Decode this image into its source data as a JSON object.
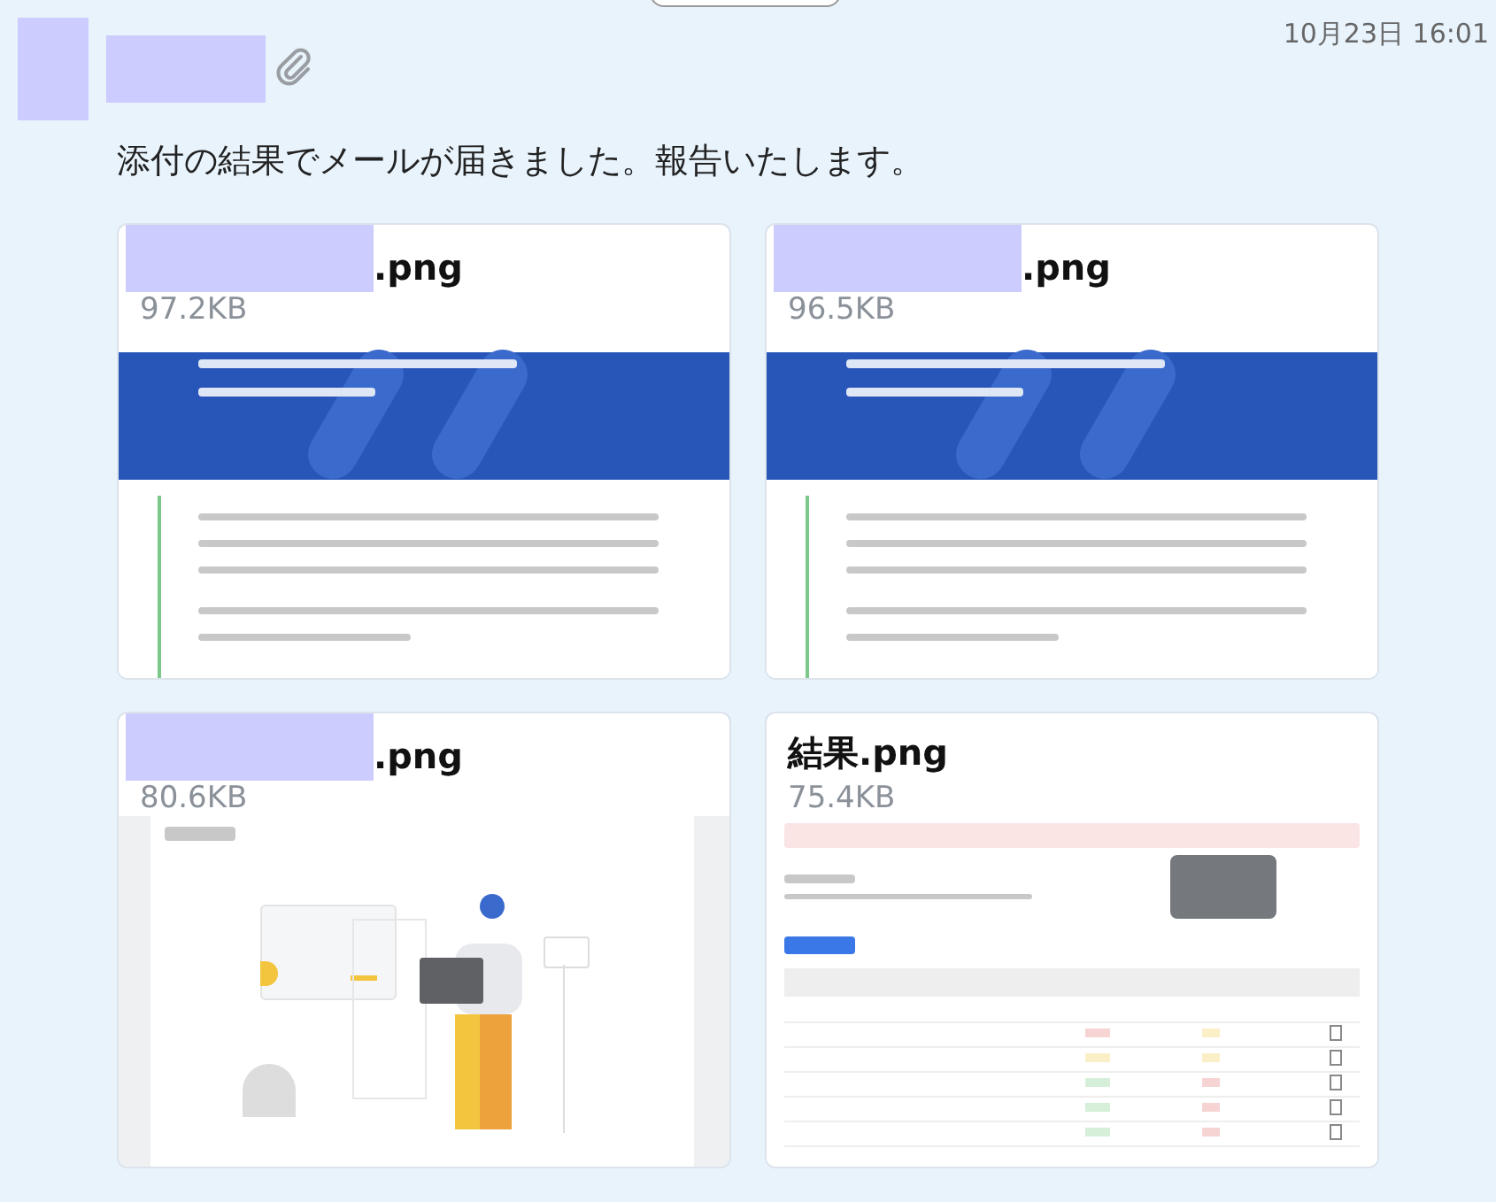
{
  "sender": {
    "redacted": true
  },
  "timestamp": "10月23日 16:01",
  "message": "添付の結果でメールが届きました。報告いたします。",
  "attachments": [
    {
      "filename": ".png",
      "redacted": true,
      "size": "97.2KB",
      "kind": "email"
    },
    {
      "filename": ".png",
      "redacted": true,
      "size": "96.5KB",
      "kind": "email"
    },
    {
      "filename": ".png",
      "redacted": true,
      "size": "80.6KB",
      "kind": "illustration"
    },
    {
      "filename": "結果.png",
      "redacted": false,
      "size": "75.4KB",
      "kind": "table"
    }
  ]
}
